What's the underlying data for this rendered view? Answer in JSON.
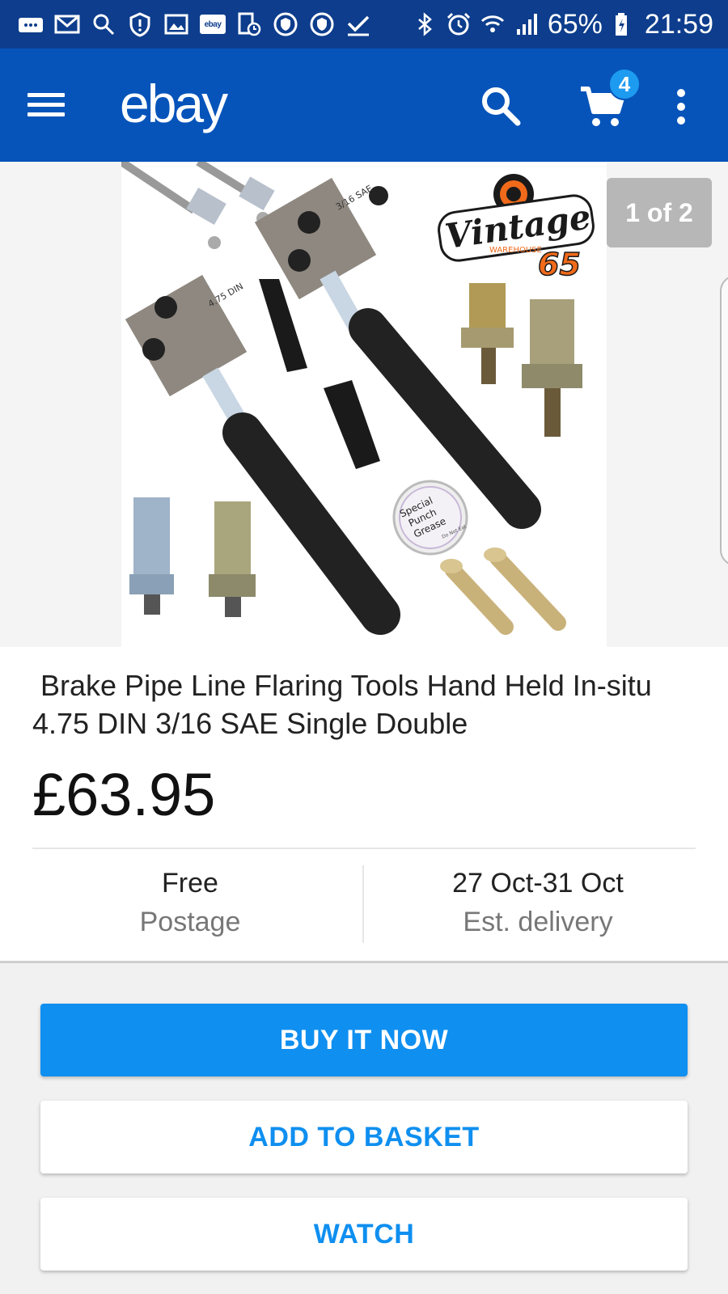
{
  "status_bar": {
    "icons": [
      "chat-icon",
      "gmail-icon",
      "search-icon",
      "alert-shield-icon",
      "image-icon",
      "ebay-icon",
      "device-clock-icon",
      "vpn-shield-icon",
      "vpn-shield-icon",
      "check-icon",
      "bluetooth-icon",
      "alarm-icon",
      "wifi-icon",
      "signal-icon",
      "battery-charging-icon"
    ],
    "ebay_badge": "ebay",
    "battery": "65%",
    "time": "21:59"
  },
  "app_bar": {
    "logo": "ebay",
    "cart_count": "4"
  },
  "carousel": {
    "counter": "1 of 2"
  },
  "product": {
    "title": " Brake Pipe Line Flaring Tools Hand Held In-situ 4.75 DIN 3/16 SAE Single Double",
    "price": "£63.95",
    "postage_value": "Free",
    "postage_label": "Postage",
    "delivery_value": "27 Oct-31 Oct",
    "delivery_label": "Est. delivery"
  },
  "image_labels": {
    "brand_line1": "Vintage",
    "brand_line2": "WAREHOUSE",
    "brand_number": "65",
    "tool_a": "3/16 SAE",
    "tool_b": "4.75 DIN",
    "grease_line1": "Special",
    "grease_line2": "Punch",
    "grease_line3": "Grease",
    "grease_line4": "Do Not Eat"
  },
  "actions": {
    "buy_now": "BUY IT NOW",
    "add_to_basket": "ADD TO BASKET",
    "watch": "WATCH"
  },
  "colors": {
    "status_bar": "#0d3d8c",
    "app_bar": "#0654ba",
    "accent": "#0f8ff0"
  }
}
